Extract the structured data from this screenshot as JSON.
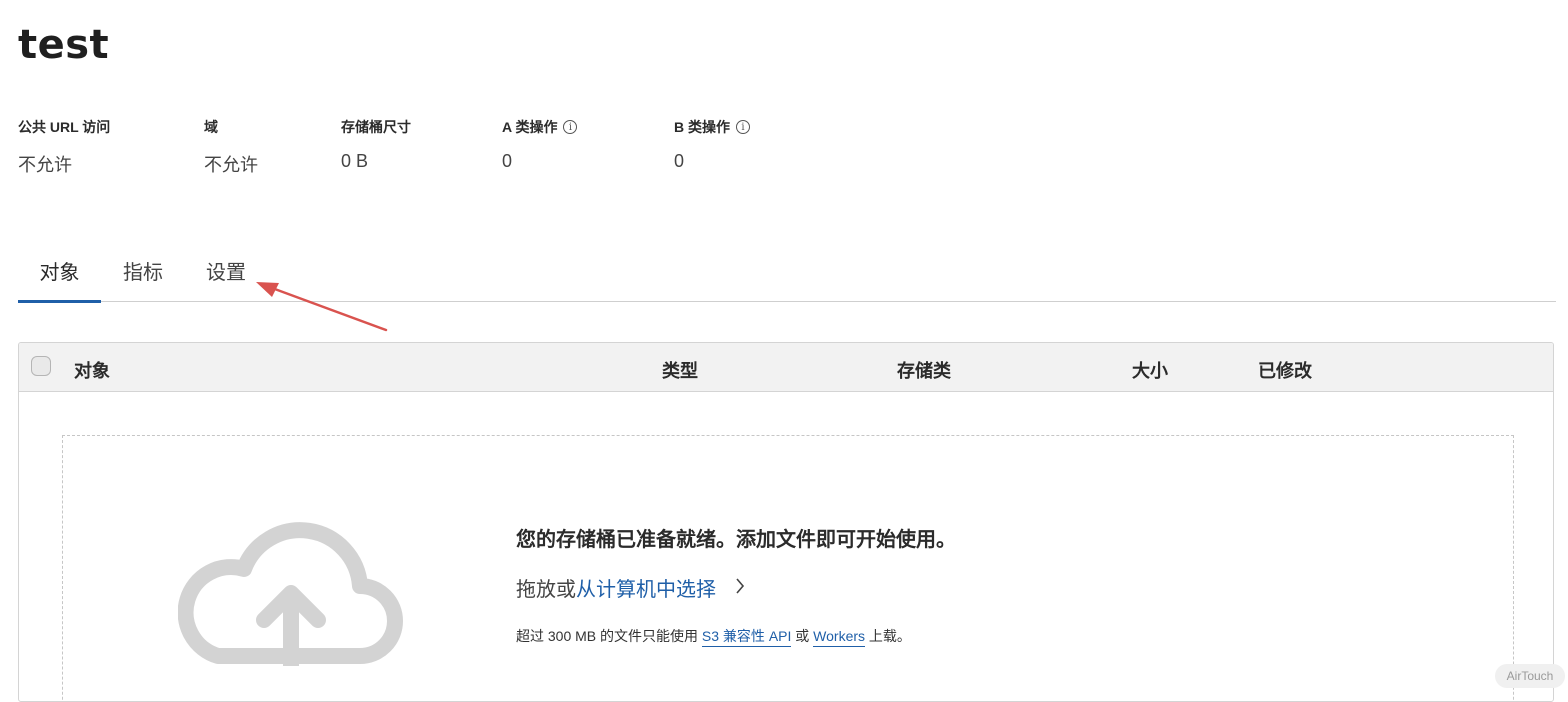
{
  "page": {
    "title": "test"
  },
  "stats": [
    {
      "label": "公共 URL 访问",
      "value": "不允许",
      "info": false
    },
    {
      "label": "域",
      "value": "不允许",
      "info": false
    },
    {
      "label": "存储桶尺寸",
      "value": "0 B",
      "info": false
    },
    {
      "label": "A 类操作",
      "value": "0",
      "info": true
    },
    {
      "label": "B 类操作",
      "value": "0",
      "info": true
    }
  ],
  "tabs": [
    {
      "label": "对象",
      "active": true
    },
    {
      "label": "指标",
      "active": false
    },
    {
      "label": "设置",
      "active": false
    }
  ],
  "table": {
    "columns": [
      "对象",
      "类型",
      "存储类",
      "大小",
      "已修改"
    ]
  },
  "dropzone": {
    "heading": "您的存储桶已准备就绪。添加文件即可开始使用。",
    "action_prefix": "拖放或",
    "action_link": "从计算机中选择",
    "note_prefix": "超过 300 MB 的文件只能使用 ",
    "note_link1": "S3 兼容性 API",
    "note_mid": " 或 ",
    "note_link2": "Workers",
    "note_suffix": " 上载。"
  },
  "badge": {
    "label": "AirTouch"
  },
  "icons": {
    "info": "info-icon",
    "cloud": "cloud-upload-icon",
    "chevron": "chevron-right-icon",
    "arrow": "annotation-arrow"
  },
  "colors": {
    "accent": "#1f5fa8",
    "arrow": "#d9534f",
    "table_header_bg": "#f2f2f2"
  }
}
